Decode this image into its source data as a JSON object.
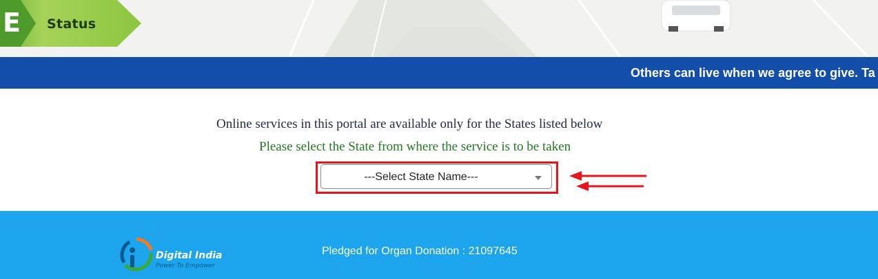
{
  "header": {
    "badge_letter": "E",
    "badge_label": "Status"
  },
  "marquee": {
    "text": "Others can live when we agree to give. Ta"
  },
  "main": {
    "availability_note": "Online services in this portal are available only for the States listed below",
    "select_prompt": "Please select the State from where the service is to be taken",
    "state_select": {
      "selected_value": "---Select State Name---"
    }
  },
  "footer": {
    "logo_title": "Digital India",
    "logo_tagline": "Power To Empower",
    "pledge_label": "Pledged for Organ Donation : 21097645"
  },
  "colors": {
    "marquee_bg": "#134eaa",
    "footer_bg": "#1ca4ec",
    "badge_green": "#8cc63f",
    "highlight_red": "#e8141b",
    "prompt_green": "#1f7a1f"
  }
}
